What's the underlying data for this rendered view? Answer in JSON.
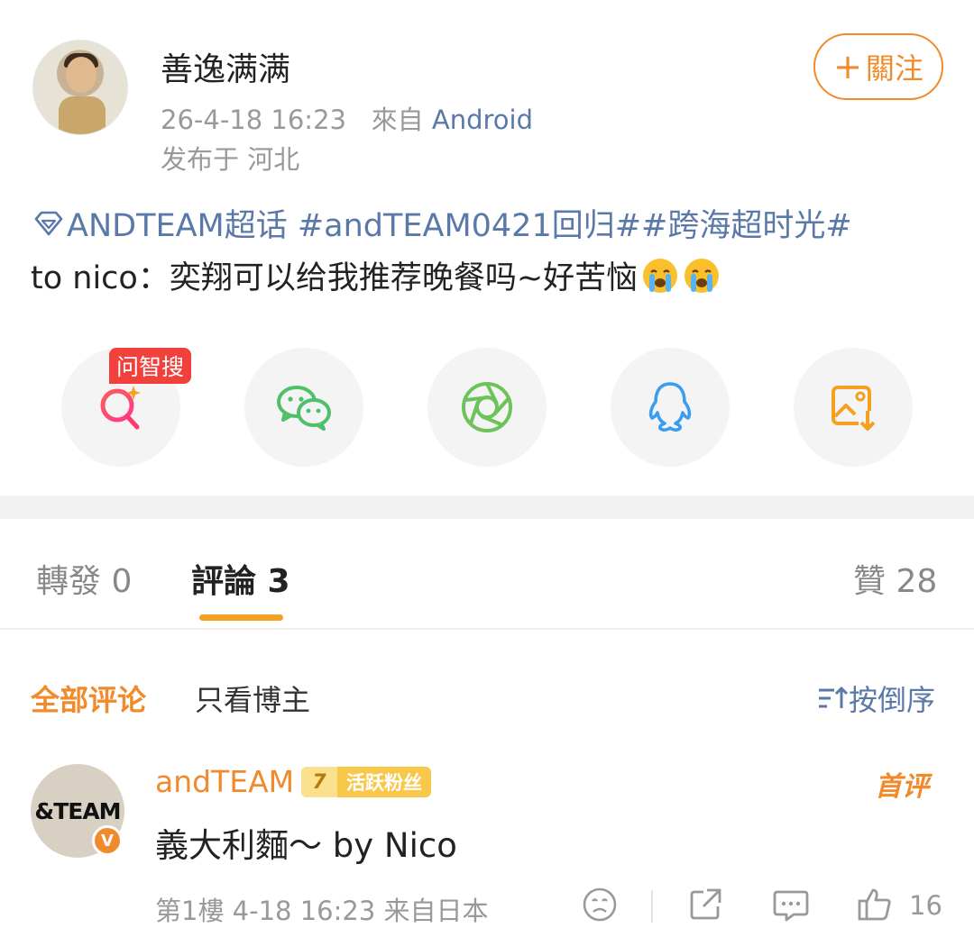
{
  "post": {
    "author": "善逸满满",
    "timestamp": "26-4-18 16:23",
    "source_prefix": "來自",
    "source": "Android",
    "location": "发布于 河北",
    "follow_label": "關注",
    "line1": "ANDTEAM超话 #andTEAM0421回归##跨海超时光#",
    "line2": "to nico：奕翔可以给我推荐晚餐吗~好苦恼"
  },
  "share": {
    "badge": "问智搜",
    "buttons": [
      "search-ai-icon",
      "wechat-icon",
      "moments-icon",
      "qq-icon",
      "save-image-icon"
    ]
  },
  "tabs": {
    "repost": "轉發 0",
    "comments": "評論 3",
    "likes": "贊 28"
  },
  "filters": {
    "all": "全部评论",
    "author_only": "只看博主",
    "sort": "按倒序"
  },
  "comment": {
    "avatar_text": "&TEAM",
    "verified": "V",
    "name": "andTEAM",
    "fan_level": "7",
    "fan_label": "活跃粉丝",
    "first_tag": "首评",
    "text": "義大利麵～ by Nico",
    "meta": "第1樓 4-18 16:23 来自日本",
    "likes": "16"
  },
  "colors": {
    "accent": "#f08a2a",
    "link": "#5a78a8",
    "badge_red": "#f2403c"
  }
}
